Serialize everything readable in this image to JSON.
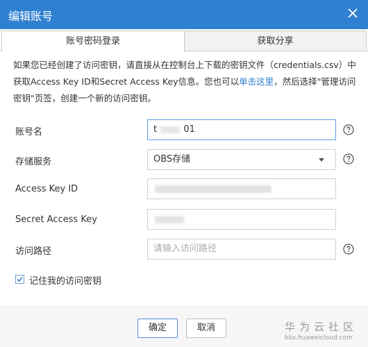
{
  "dialog": {
    "title": "编辑账号",
    "close_icon": "close-icon"
  },
  "tabs": [
    {
      "label": "账号密码登录",
      "active": true
    },
    {
      "label": "获取分享",
      "active": false
    }
  ],
  "description": {
    "text_before_link": "如果您已经创建了访问密钥，请直接从在控制台上下载的密钥文件（credentials.csv）中获取Access Key ID和Secret Access Key信息。您也可以",
    "link": "单击这里",
    "text_after_link": "，然后选择\"管理访问密钥\"页签，创建一个新的访问密钥。"
  },
  "form": {
    "account_name": {
      "label": "账号名",
      "value_start": "t",
      "value_end": "01"
    },
    "storage_service": {
      "label": "存储服务",
      "value": "OBS存储"
    },
    "access_key_id": {
      "label": "Access Key ID",
      "value": ""
    },
    "secret_access_key": {
      "label": "Secret Access Key",
      "value": ""
    },
    "access_path": {
      "label": "访问路径",
      "placeholder": "请输入访问路径"
    }
  },
  "remember": {
    "label": "记住我的访问密钥",
    "checked": true
  },
  "buttons": {
    "ok": "确定",
    "cancel": "取消"
  },
  "watermark": {
    "text": "华为云社区",
    "url": "bbs.huaweicloud.com"
  },
  "colors": {
    "accent": "#2f80d1",
    "border": "#cfcfcf",
    "footer": "#f6f6f6"
  }
}
